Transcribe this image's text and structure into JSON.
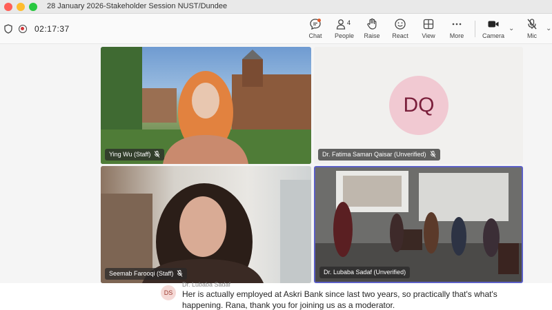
{
  "window": {
    "title": "28 January 2026-Stakeholder Session NUST/Dundee"
  },
  "toolbar": {
    "timer": "02:17:37",
    "buttons": {
      "chat": "Chat",
      "people": "People",
      "people_count": "4",
      "raise": "Raise",
      "react": "React",
      "view": "View",
      "more": "More",
      "camera": "Camera",
      "mic": "Mic"
    }
  },
  "participants": [
    {
      "name": "Ying Wu (Staff)"
    },
    {
      "name": "Dr. Fatima Saman Qaisar (Unverified)",
      "initials": "DQ"
    },
    {
      "name": "Seemab Farooqi (Staff)"
    },
    {
      "name": "Dr. Lubaba Sadaf (Unverified)"
    }
  ],
  "caption": {
    "speaker_initials": "DS",
    "speaker": "Dr. Lubaba Sadaf",
    "text": "Her is actually employed at Askri Bank since last two years, so practically that's what's happening. Rana, thank you for joining us as a moderator."
  },
  "colors": {
    "accent": "#5b5fc7",
    "recording": "#d13438",
    "avatar_bg": "#f1c9d2"
  }
}
